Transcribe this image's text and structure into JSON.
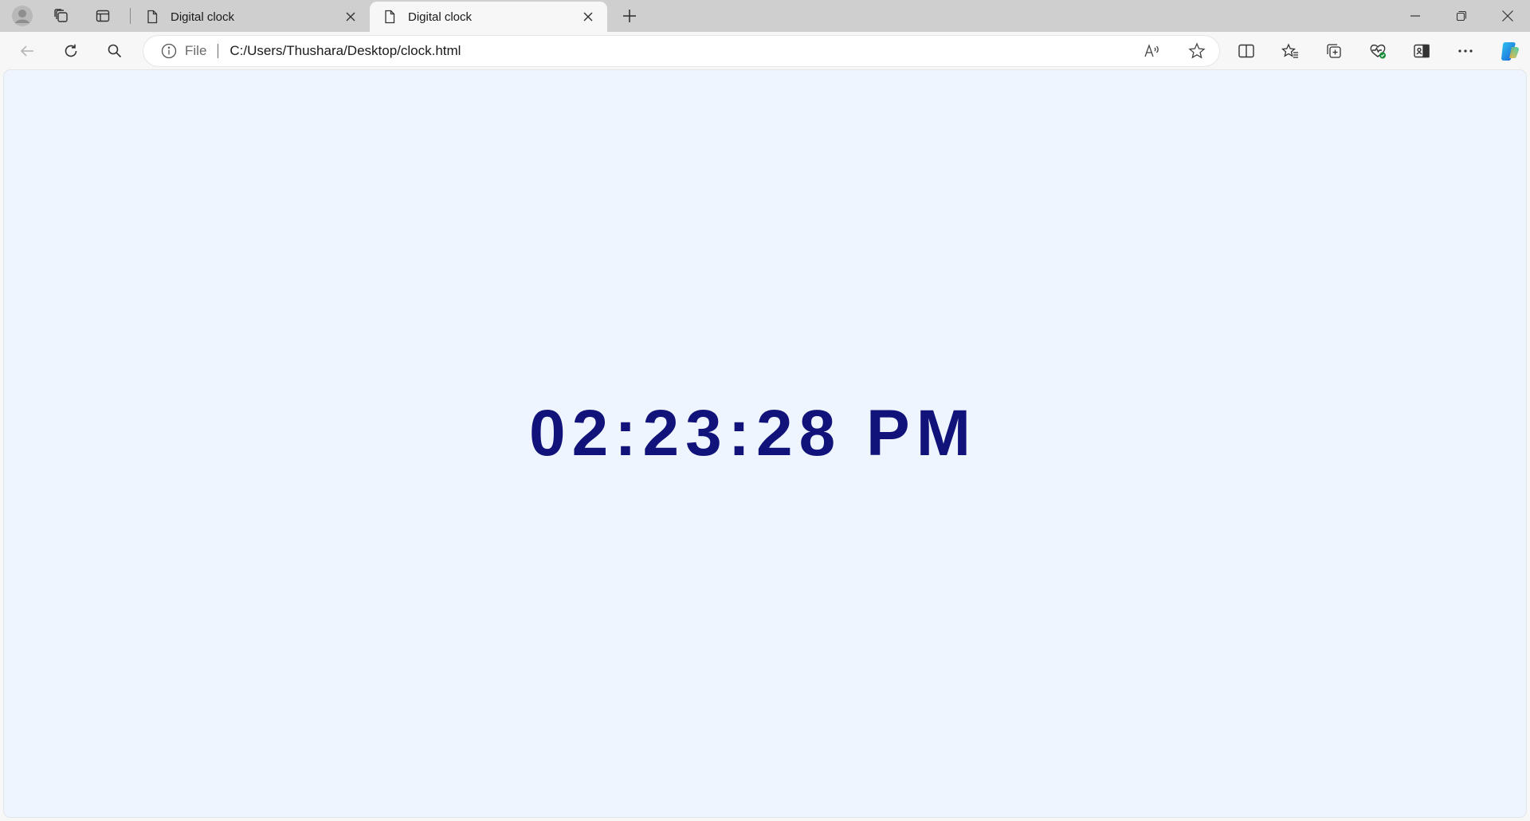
{
  "browser": {
    "tabs": [
      {
        "title": "Digital clock",
        "active": false
      },
      {
        "title": "Digital clock",
        "active": true
      }
    ],
    "address": {
      "scheme_label": "File",
      "url": "C:/Users/Thushara/Desktop/clock.html"
    },
    "icons": {
      "profile": "profile-icon",
      "workspaces": "workspaces-icon",
      "tab_actions": "tab-actions-icon",
      "new_tab": "plus-icon",
      "minimize": "minimize-icon",
      "restore": "restore-icon",
      "close": "close-icon",
      "back": "back-arrow-icon",
      "refresh": "refresh-icon",
      "search": "search-icon",
      "info": "info-icon",
      "read_aloud": "read-aloud-icon",
      "favorite": "star-icon",
      "split_screen": "split-screen-icon",
      "favorites": "favorites-icon",
      "collections": "collections-icon",
      "browser_essentials": "heart-pulse-icon",
      "sidebar": "sidebar-icon",
      "more": "more-icon",
      "copilot": "copilot-icon"
    }
  },
  "page": {
    "clock_display": "02:23:28 PM",
    "colors": {
      "background": "#eef5fe",
      "clock_text": "#12137a"
    }
  }
}
